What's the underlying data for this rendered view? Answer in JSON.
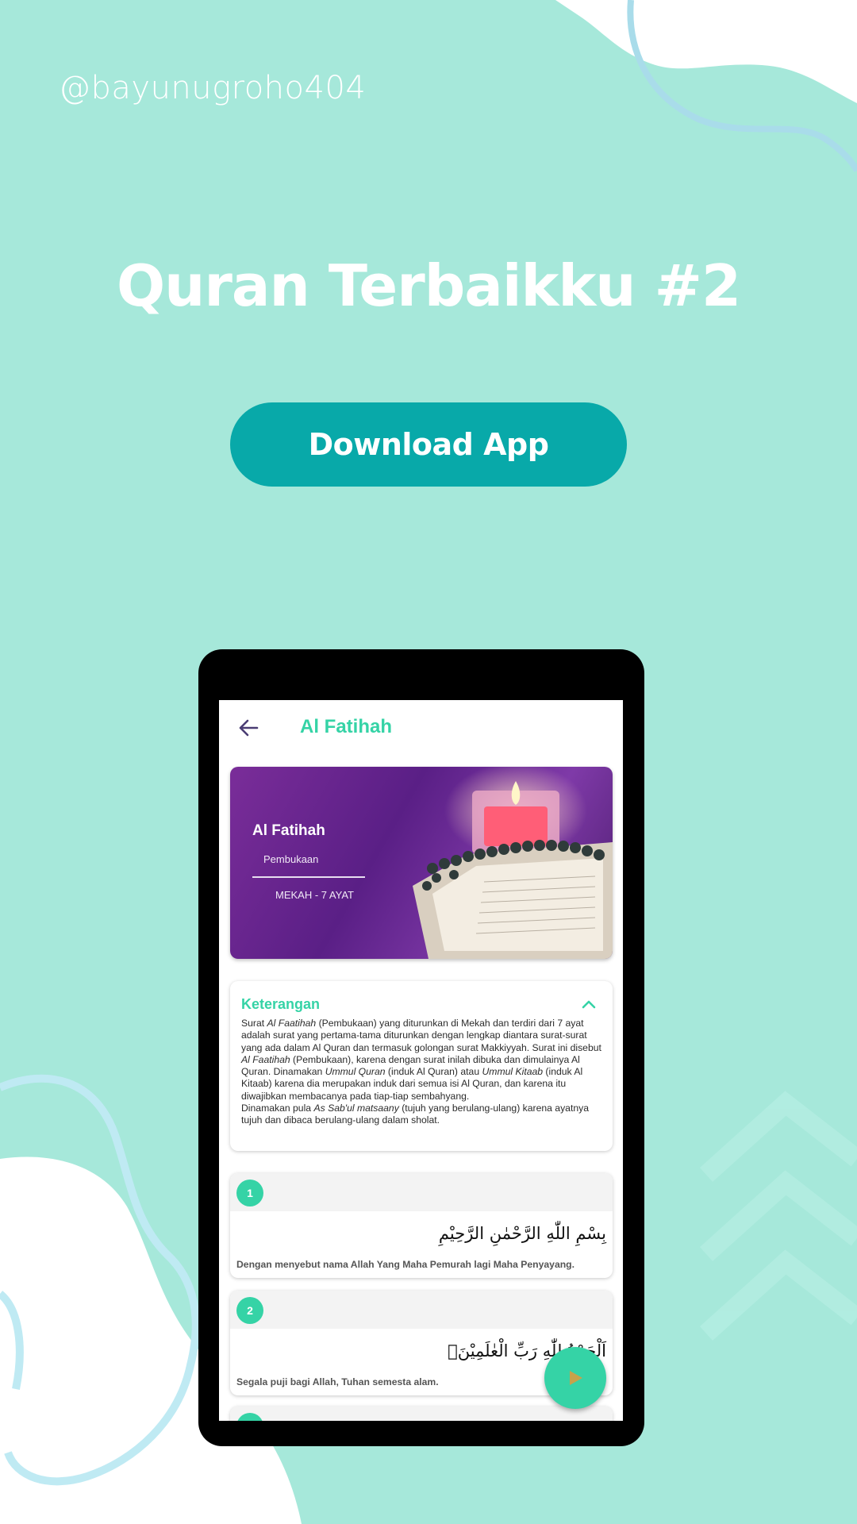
{
  "colors": {
    "background": "#a6e8da",
    "download_button": "#08a9a9",
    "accent": "#35d3a6",
    "banner_purple": "#5a1f86"
  },
  "handle": "@bayunugroho404",
  "headline": "Quran Terbaikku #2",
  "download_button": {
    "label": "Download App"
  },
  "app": {
    "back_icon": "arrow-left-icon",
    "title": "Al Fatihah",
    "banner": {
      "surah_name": "Al Fatihah",
      "meaning": "Pembukaan",
      "meta": "MEKAH - 7 AYAT"
    },
    "info_card": {
      "title": "Keterangan",
      "toggle_icon": "chevron-up-icon",
      "body_segments": [
        {
          "text": "Surat ",
          "italic": false
        },
        {
          "text": "Al Faatihah",
          "italic": true
        },
        {
          "text": " (Pembukaan) yang diturunkan di Mekah dan terdiri dari 7 ayat adalah surat yang pertama-tama diturunkan dengan lengkap diantara surat-surat yang ada dalam Al Quran dan termasuk golongan surat Makkiyyah. Surat ini disebut ",
          "italic": false
        },
        {
          "text": "Al Faatihah",
          "italic": true
        },
        {
          "text": " (Pembukaan), karena dengan surat inilah dibuka dan dimulainya Al Quran. Dinamakan ",
          "italic": false
        },
        {
          "text": "Ummul Quran",
          "italic": true
        },
        {
          "text": " (induk Al Quran) atau ",
          "italic": false
        },
        {
          "text": "Ummul Kitaab",
          "italic": true
        },
        {
          "text": " (induk Al Kitaab) karena dia merupakan induk dari semua isi Al Quran, dan karena itu diwajibkan membacanya pada tiap-tiap sembahyang.",
          "italic": false
        },
        {
          "text": "\n",
          "italic": false
        },
        {
          "text": "Dinamakan pula ",
          "italic": false
        },
        {
          "text": "As Sab'ul matsaany",
          "italic": true
        },
        {
          "text": " (tujuh yang berulang-ulang) karena ayatnya tujuh dan dibaca berulang-ulang dalam sholat.",
          "italic": false
        }
      ]
    },
    "ayahs": [
      {
        "number": "1",
        "arabic": "بِسْمِ اللّٰهِ الرَّحْمٰنِ الرَّحِيْمِ",
        "translation": "Dengan menyebut nama Allah Yang Maha Pemurah lagi Maha Penyayang."
      },
      {
        "number": "2",
        "arabic": "اَلْحَمْدُ لِلّٰهِ رَبِّ الْعٰلَمِيْنَۙ",
        "translation": "Segala puji bagi Allah, Tuhan semesta alam."
      }
    ],
    "fab_icon": "play-icon"
  }
}
